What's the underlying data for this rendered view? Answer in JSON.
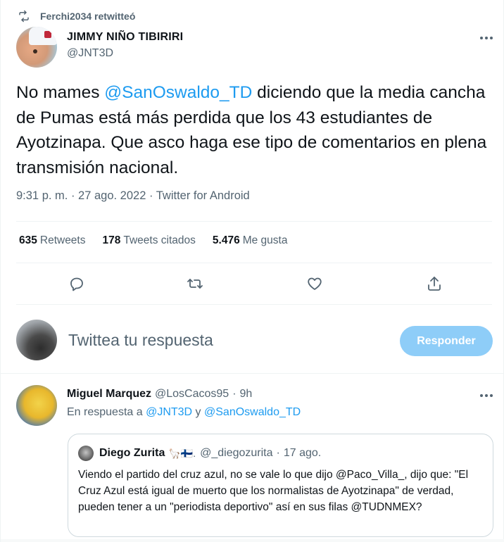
{
  "retweet": {
    "label": "Ferchi2034 retwitteó",
    "icon": "retweet-icon"
  },
  "tweet": {
    "author_name": "JIMMY NIÑO TIBIRIRI",
    "author_handle": "@JNT3D",
    "text_before": "No mames ",
    "mention": "@SanOswaldo_TD",
    "text_after": " diciendo que la media cancha de Pumas está más perdida que los 43 estudiantes de Ayotzinapa. Que asco haga ese tipo de comentarios en plena transmisión nacional.",
    "meta": "9:31 p. m. · 27 ago. 2022 · Twitter for Android"
  },
  "stats": {
    "retweets_count": "635",
    "retweets_label": "Retweets",
    "quotes_count": "178",
    "quotes_label": "Tweets citados",
    "likes_count": "5.476",
    "likes_label": "Me gusta"
  },
  "actions": [
    "reply-icon",
    "retweet-icon",
    "like-icon",
    "share-icon"
  ],
  "compose": {
    "placeholder": "Twittea tu respuesta",
    "button_label": "Responder"
  },
  "reply": {
    "name": "Miguel Marquez",
    "handle": "@LosCacos95",
    "dot": "·",
    "time": "9h",
    "in_reply_prefix": "En respuesta a ",
    "in_reply_user1": "@JNT3D",
    "in_reply_conj": " y ",
    "in_reply_user2": "@SanOswaldo_TD",
    "quote": {
      "name": "Diego Zurita",
      "flag": "🦙🇫🇮.",
      "handle": "@_diegozurita",
      "dot": "·",
      "time": "17 ago.",
      "text": "Viendo el partido del cruz azul, no se vale lo que dijo @Paco_Villa_, dijo que: \"El Cruz Azul está igual de muerto que los normalistas de Ayotzinapa\" de verdad, pueden tener a un \"periodista deportivo\" así en sus filas @TUDNMEX?"
    }
  },
  "colors": {
    "accent": "#1d9bf0",
    "button": "#8ecdf8",
    "secondary_text": "#536471",
    "border": "#cfd9de"
  }
}
